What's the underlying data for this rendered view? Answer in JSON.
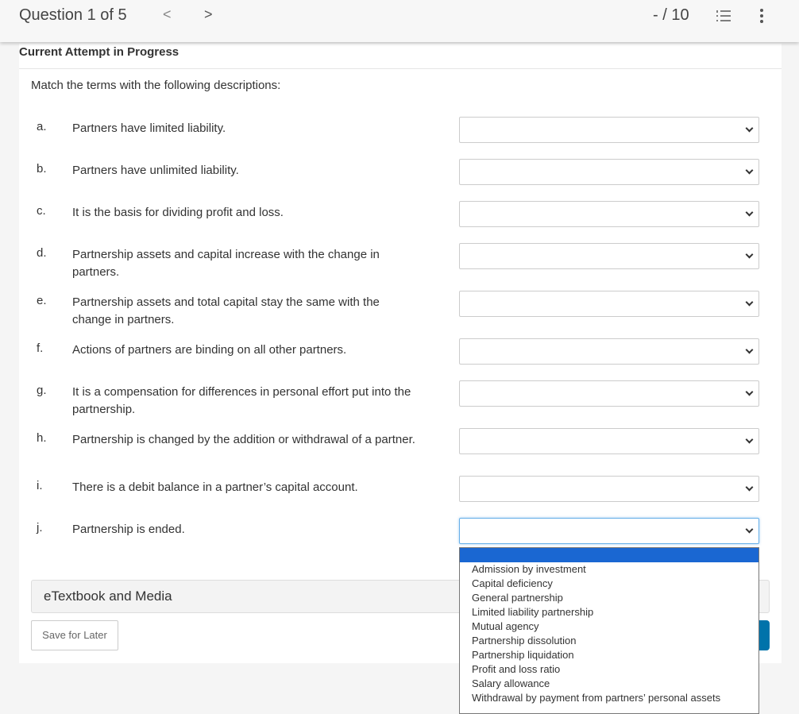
{
  "header": {
    "question": "Question 1 of 5",
    "prev_icon": "chevron-left-icon",
    "next_icon": "chevron-right-icon",
    "prev": "<",
    "next": ">",
    "score": "- / 10",
    "list_icon": "numbered-list-icon",
    "more_icon": "vertical-ellipsis-icon"
  },
  "attempt": "Current Attempt in Progress",
  "prompt": "Match the terms with the following descriptions:",
  "rows": [
    {
      "letter": "a.",
      "text": "Partners have limited liability."
    },
    {
      "letter": "b.",
      "text": "Partners have unlimited liability."
    },
    {
      "letter": "c.",
      "text": "It is the basis for dividing profit and loss."
    },
    {
      "letter": "d.",
      "text": "Partnership assets and capital increase with the change in partners."
    },
    {
      "letter": "e.",
      "text": "Partnership assets and total capital stay the same with the change in partners."
    },
    {
      "letter": "f.",
      "text": "Actions of partners are binding on all other partners."
    },
    {
      "letter": "g.",
      "text": "It is a compensation for differences in personal effort put into the partnership."
    },
    {
      "letter": "h.",
      "text": "Partnership is changed by the addition or withdrawal of a partner."
    },
    {
      "letter": "i.",
      "text": "There is a debit balance in a partner’s capital account."
    },
    {
      "letter": "j.",
      "text": "Partnership is ended."
    }
  ],
  "options": [
    "",
    "Admission by investment",
    "Capital deficiency",
    "General partnership",
    "Limited liability partnership",
    "Mutual agency",
    "Partnership dissolution",
    "Partnership liquidation",
    "Profit and loss ratio",
    "Salary allowance",
    "Withdrawal by payment from partners’ personal assets"
  ],
  "etextbook": "eTextbook and Media",
  "save_label": "Save for Later",
  "colors": {
    "highlight": "#1a67d2",
    "submit": "#0073aa"
  }
}
